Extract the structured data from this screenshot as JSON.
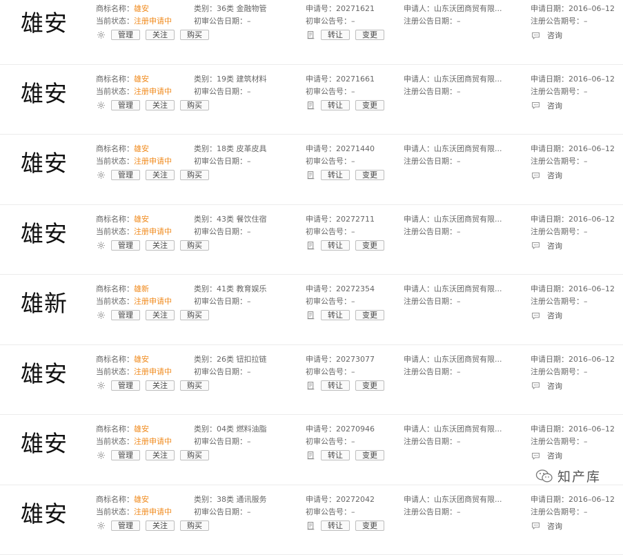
{
  "labels": {
    "name": "商标名称：",
    "category": "类别：",
    "status": "当前状态：",
    "first_pub_date": "初审公告日期：",
    "reg_no": "申请号：",
    "first_pub_no": "初审公告号：",
    "applicant": "申请人：",
    "reg_pub_date": "注册公告日期：",
    "apply_date": "申请日期：",
    "reg_pub_no": "注册公告期号："
  },
  "buttons": {
    "manage": "管理",
    "follow": "关注",
    "buy": "购买",
    "transfer": "转让",
    "change": "变更",
    "consult": "咨询"
  },
  "colors": {
    "status": "#f08a1c",
    "accent": "#f08a1c"
  },
  "icons": {
    "settings": "gear-icon",
    "doc": "document-icon",
    "consult": "chat-icon",
    "watermark": "wechat-icon"
  },
  "watermark": {
    "text": "知产库"
  },
  "records": [
    {
      "mark": "雄安",
      "name": "雄安",
      "category": "36类 金融物管",
      "status": "注册申请中",
      "first_pub_date": "–",
      "reg_no": "20271621",
      "first_pub_no": "–",
      "applicant": "山东沃团商贸有限...",
      "reg_pub_date": "–",
      "apply_date": "2016–06–12",
      "reg_pub_no": "–"
    },
    {
      "mark": "雄安",
      "name": "雄安",
      "category": "19类 建筑材料",
      "status": "注册申请中",
      "first_pub_date": "–",
      "reg_no": "20271661",
      "first_pub_no": "–",
      "applicant": "山东沃团商贸有限...",
      "reg_pub_date": "–",
      "apply_date": "2016–06–12",
      "reg_pub_no": "–"
    },
    {
      "mark": "雄安",
      "name": "雄安",
      "category": "18类 皮革皮具",
      "status": "注册申请中",
      "first_pub_date": "–",
      "reg_no": "20271440",
      "first_pub_no": "–",
      "applicant": "山东沃团商贸有限...",
      "reg_pub_date": "–",
      "apply_date": "2016–06–12",
      "reg_pub_no": "–"
    },
    {
      "mark": "雄安",
      "name": "雄安",
      "category": "43类 餐饮住宿",
      "status": "注册申请中",
      "first_pub_date": "–",
      "reg_no": "20272711",
      "first_pub_no": "–",
      "applicant": "山东沃团商贸有限...",
      "reg_pub_date": "–",
      "apply_date": "2016–06–12",
      "reg_pub_no": "–"
    },
    {
      "mark": "雄新",
      "name": "雄新",
      "category": "41类 教育娱乐",
      "status": "注册申请中",
      "first_pub_date": "–",
      "reg_no": "20272354",
      "first_pub_no": "–",
      "applicant": "山东沃团商贸有限...",
      "reg_pub_date": "–",
      "apply_date": "2016–06–12",
      "reg_pub_no": "–"
    },
    {
      "mark": "雄安",
      "name": "雄安",
      "category": "26类 钮扣拉链",
      "status": "注册申请中",
      "first_pub_date": "–",
      "reg_no": "20273077",
      "first_pub_no": "–",
      "applicant": "山东沃团商贸有限...",
      "reg_pub_date": "–",
      "apply_date": "2016–06–12",
      "reg_pub_no": "–"
    },
    {
      "mark": "雄安",
      "name": "雄安",
      "category": "04类 燃料油脂",
      "status": "注册申请中",
      "first_pub_date": "–",
      "reg_no": "20270946",
      "first_pub_no": "–",
      "applicant": "山东沃团商贸有限...",
      "reg_pub_date": "–",
      "apply_date": "2016–06–12",
      "reg_pub_no": "–"
    },
    {
      "mark": "雄安",
      "name": "雄安",
      "category": "38类 通讯服务",
      "status": "注册申请中",
      "first_pub_date": "–",
      "reg_no": "20272042",
      "first_pub_no": "–",
      "applicant": "山东沃团商贸有限...",
      "reg_pub_date": "–",
      "apply_date": "2016–06–12",
      "reg_pub_no": "–"
    }
  ]
}
